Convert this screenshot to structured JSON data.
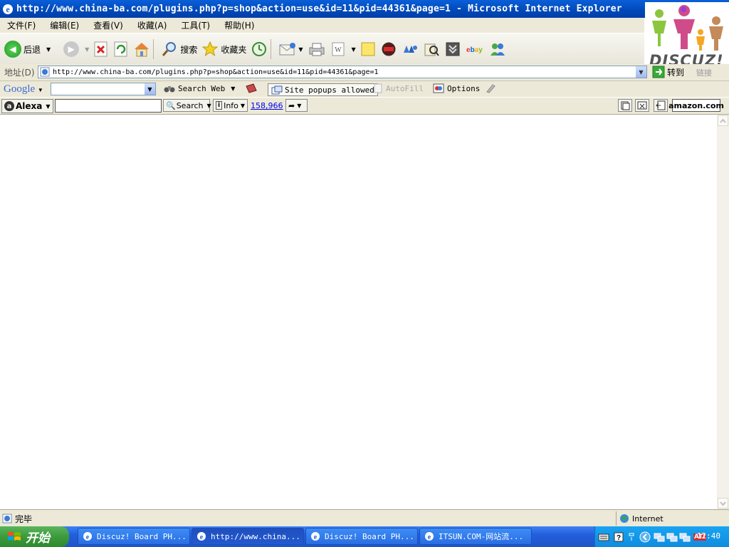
{
  "window": {
    "title": "http://www.china-ba.com/plugins.php?p=shop&action=use&id=11&pid=44361&page=1 - Microsoft Internet Explorer"
  },
  "logo": {
    "text": "DISCUZ!"
  },
  "menu": {
    "items": [
      "文件(F)",
      "编辑(E)",
      "查看(V)",
      "收藏(A)",
      "工具(T)",
      "帮助(H)"
    ]
  },
  "toolbar": {
    "back_label": "后退",
    "search_label": "搜索",
    "favorites_label": "收藏夹",
    "word_label": "W"
  },
  "address": {
    "label": "地址(D)",
    "url": "http://www.china-ba.com/plugins.php?p=shop&action=use&id=11&pid=44361&page=1",
    "go_label": "转到",
    "links_label": "链接"
  },
  "google": {
    "logo": "Google",
    "search_web_label": "Search Web",
    "popups_label": "Site popups allowed",
    "autofill_label": "AutoFill",
    "options_label": "Options"
  },
  "alexa": {
    "logo": "Alexa",
    "search_label": "Search",
    "info_label": "Info",
    "rank": "158,966",
    "amazon_label": "amazon.com"
  },
  "status": {
    "text": "完毕",
    "zone": "Internet"
  },
  "taskbar": {
    "start_label": "开始",
    "tasks": [
      {
        "label": "Discuz! Board PH..."
      },
      {
        "label": "http://www.china..."
      },
      {
        "label": "Discuz! Board PH..."
      },
      {
        "label": "ITSUN.COM-网站流..."
      }
    ],
    "clock": "12:40",
    "ati_label": "ATI"
  }
}
